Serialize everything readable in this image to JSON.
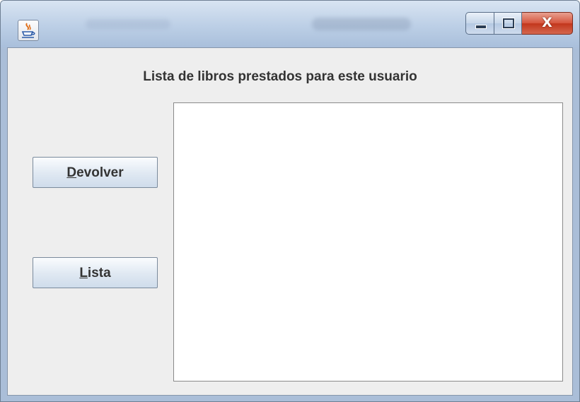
{
  "window": {
    "icon": "java-cup-icon",
    "caption_buttons": {
      "minimize_icon": "minimize-icon",
      "maximize_icon": "maximize-icon",
      "close_label": "X"
    }
  },
  "main": {
    "heading": "Lista de libros prestados para este usuario",
    "buttons": {
      "devolver": {
        "mnemonic": "D",
        "rest": "evolver"
      },
      "lista": {
        "mnemonic": "L",
        "rest": "ista"
      }
    },
    "list_items": []
  },
  "colors": {
    "panel_background": "#eeeeee",
    "close_button": "#c9462c",
    "frame": "#b6c9e0"
  }
}
